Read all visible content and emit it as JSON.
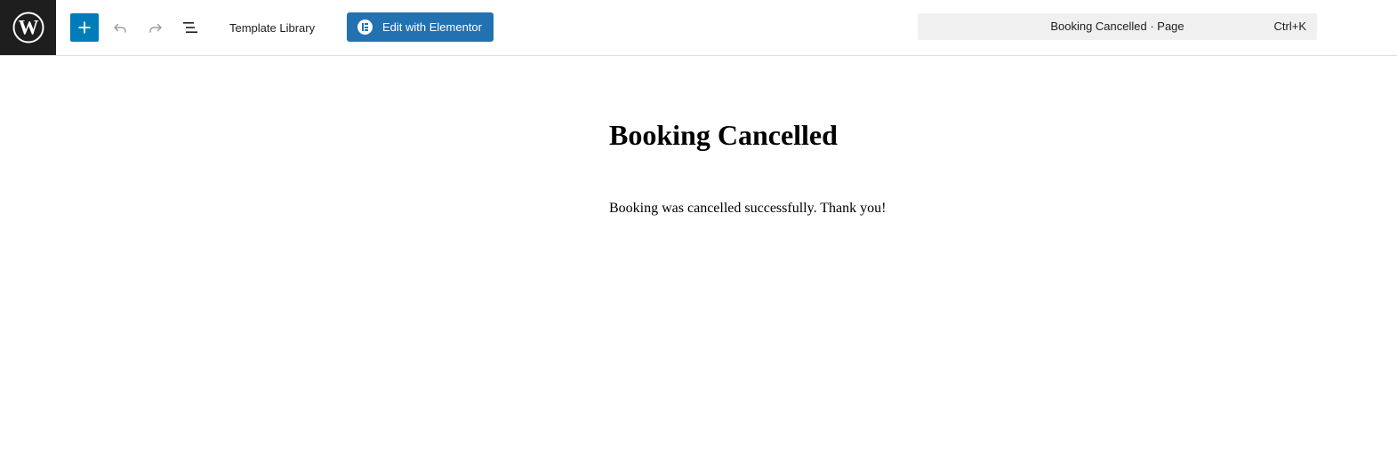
{
  "header": {
    "toolbar": {
      "template_library_label": "Template Library",
      "edit_with_elementor_label": "Edit with Elementor"
    },
    "command_bar": {
      "document_title": "Booking Cancelled · Page",
      "shortcut": "Ctrl+K"
    }
  },
  "content": {
    "title": "Booking Cancelled",
    "paragraph": "Booking was cancelled successfully. Thank you!"
  },
  "colors": {
    "accent": "#007cba",
    "elementor_button": "#2271b1",
    "logo_background": "#1e1e1e",
    "command_bar_background": "#f0f0f0"
  },
  "icons": {
    "logo": "wordpress-logo-icon",
    "inserter": "plus-icon",
    "undo": "undo-icon",
    "redo": "redo-icon",
    "outline": "list-view-icon",
    "elementor": "elementor-icon"
  }
}
